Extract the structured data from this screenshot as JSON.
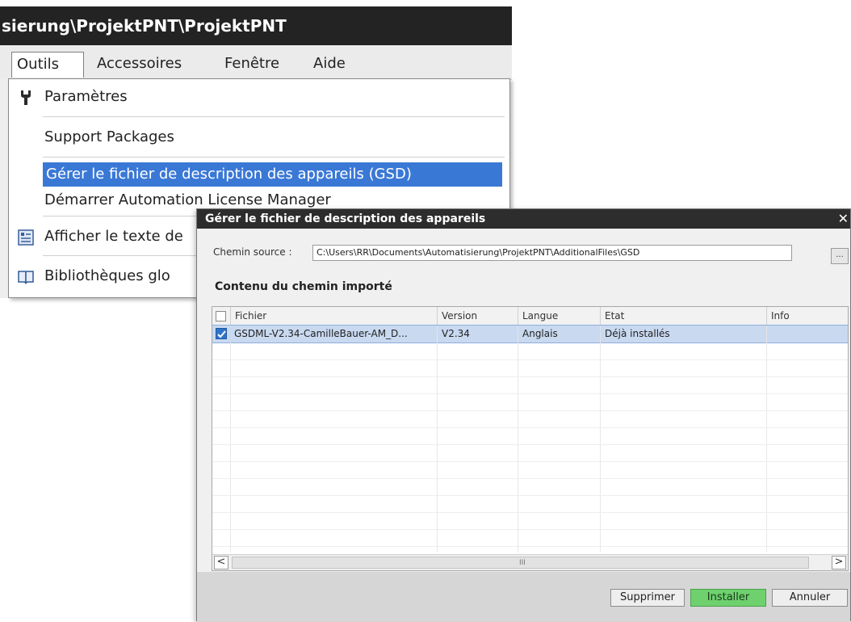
{
  "app": {
    "title": "sierung\\ProjektPNT\\ProjektPNT",
    "menu": [
      "Outils",
      "Accessoires",
      "Fenêtre",
      "Aide"
    ],
    "active_menu_index": 0
  },
  "dropdown": {
    "items": [
      {
        "label": "Paramètres",
        "icon": "wrench-icon"
      },
      {
        "label": "Support Packages",
        "icon": null
      },
      {
        "label": "Gérer le fichier de description des appareils (GSD)",
        "icon": null,
        "highlighted": true
      },
      {
        "label": "Démarrer Automation License Manager",
        "icon": null
      },
      {
        "label": "Afficher le texte de",
        "icon": "text-list-icon"
      },
      {
        "label": "Bibliothèques glo",
        "icon": "book-icon"
      }
    ]
  },
  "dialog": {
    "title": "Gérer le fichier de description des appareils",
    "source_label": "Chemin source :",
    "source_path": "C:\\Users\\RR\\Documents\\Automatisierung\\ProjektPNT\\AdditionalFiles\\GSD",
    "browse_label": "...",
    "section_title": "Contenu du chemin importé",
    "columns": [
      "Fichier",
      "Version",
      "Langue",
      "Etat",
      "Info"
    ],
    "rows": [
      {
        "checked": true,
        "file": "GSDML-V2.34-CamilleBauer-AM_D...",
        "version": "V2.34",
        "language": "Anglais",
        "state": "Déjà installés",
        "info": ""
      }
    ],
    "scroll_left": "<",
    "scroll_right": ">",
    "scroll_grip": "III",
    "buttons": {
      "delete": "Supprimer",
      "install": "Installer",
      "cancel": "Annuler"
    },
    "colors": {
      "title_bg": "#2d2d2d",
      "highlight": "#3a78d6",
      "selected_row": "#c9d9f0",
      "install_button": "#6ed16e"
    }
  }
}
